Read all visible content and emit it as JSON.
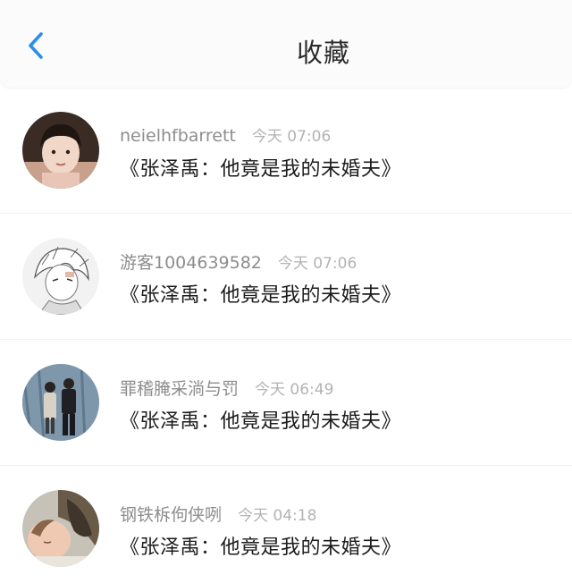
{
  "header": {
    "title": "收藏",
    "back_icon": "chevron-left-icon",
    "accent": "#2b8ee8"
  },
  "items": [
    {
      "username": "neielhfbarrett",
      "time": "今天 07:06",
      "content": "《张泽禹：他竟是我的未婚夫》"
    },
    {
      "username": "游客1004639582",
      "time": "今天 07:06",
      "content": "《张泽禹：他竟是我的未婚夫》"
    },
    {
      "username": "罪稽腌采淌与罚",
      "time": "今天 06:49",
      "content": "《张泽禹：他竟是我的未婚夫》"
    },
    {
      "username": "钢铁柝佝侠咧",
      "time": "今天 04:18",
      "content": "《张泽禹：他竟是我的未婚夫》"
    }
  ]
}
